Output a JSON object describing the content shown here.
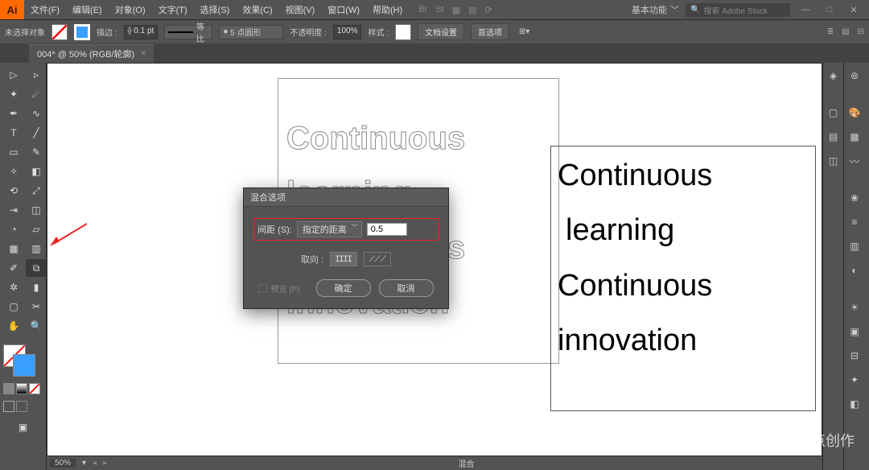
{
  "app": {
    "logo": "Ai"
  },
  "menu": [
    "文件(F)",
    "编辑(E)",
    "对象(O)",
    "文字(T)",
    "选择(S)",
    "效果(C)",
    "视图(V)",
    "窗口(W)",
    "帮助(H)"
  ],
  "header_right": {
    "workspace": "基本功能",
    "search_placeholder": "搜索 Adobe Stock"
  },
  "options": {
    "selection_status": "未选择对象",
    "stroke_label": "描边 :",
    "stroke_width": "0.1 pt",
    "profile_label": "等比",
    "brush_label": "5 点圆形",
    "opacity_label": "不透明度 :",
    "opacity_value": "100%",
    "style_label": "样式 :",
    "doc_setup": "文档设置",
    "prefs": "首选项"
  },
  "tab": {
    "name": "004* @ 50% (RGB/轮廓)",
    "close": "×"
  },
  "canvas": {
    "outline_lines": [
      "Continuous",
      "learning",
      "Continuous",
      "innovation"
    ],
    "solid_lines": [
      "Continuous",
      "learning",
      "Continuous",
      "innovation"
    ]
  },
  "dialog": {
    "title": "混合选项",
    "spacing_label": "间距 (S):",
    "spacing_select": "指定的距离",
    "spacing_value": "0.5",
    "orient_label": "取向 :",
    "preview_label": "预览 (P)",
    "ok": "确定",
    "cancel": "取消"
  },
  "status": {
    "zoom": "50%",
    "mode": "混合"
  },
  "watermark": "整点创作"
}
